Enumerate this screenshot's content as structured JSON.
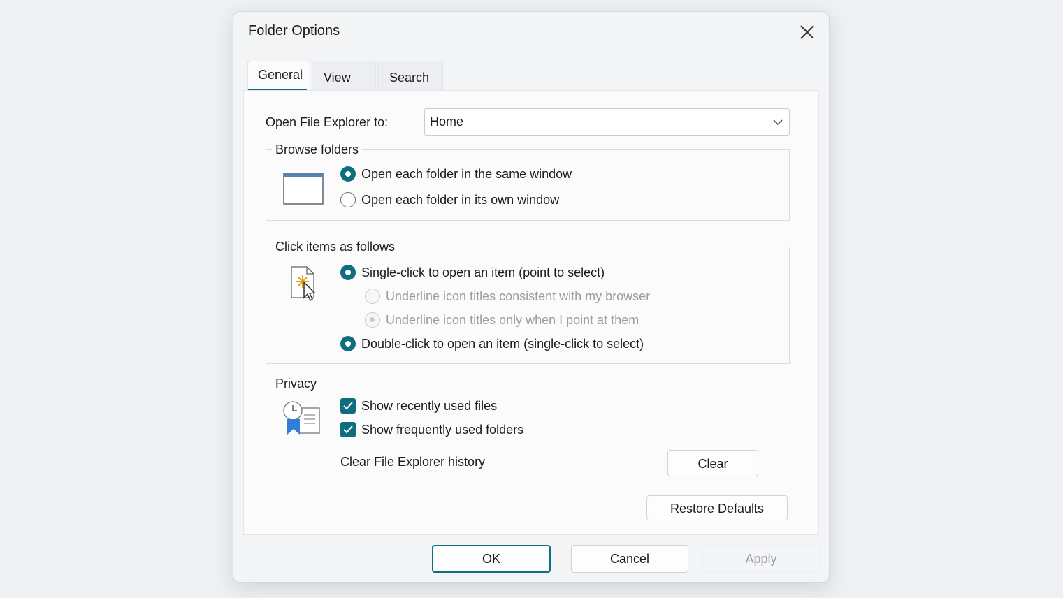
{
  "dialog": {
    "title": "Folder Options"
  },
  "tabs": [
    {
      "label": "General",
      "active": true
    },
    {
      "label": "View",
      "active": false
    },
    {
      "label": "Search",
      "active": false
    }
  ],
  "open_to": {
    "label": "Open File Explorer to:",
    "value": "Home"
  },
  "browse": {
    "title": "Browse folders",
    "options": [
      {
        "label": "Open each folder in the same window",
        "selected": true
      },
      {
        "label": "Open each folder in its own window",
        "selected": false
      }
    ]
  },
  "click": {
    "title": "Click items as follows",
    "options": [
      {
        "label": "Single-click to open an item (point to select)",
        "selected": true
      },
      {
        "label": "Underline icon titles consistent with my browser",
        "selected": false,
        "disabled": true
      },
      {
        "label": "Underline icon titles only when I point at them",
        "selected": true,
        "disabled": true
      },
      {
        "label": "Double-click to open an item (single-click to select)",
        "selected": true
      }
    ]
  },
  "privacy": {
    "title": "Privacy",
    "checks": [
      {
        "label": "Show recently used files",
        "checked": true
      },
      {
        "label": "Show frequently used folders",
        "checked": true
      }
    ],
    "clear_label": "Clear File Explorer history",
    "clear_button": "Clear"
  },
  "restore_button": "Restore Defaults",
  "footer": {
    "ok": "OK",
    "cancel": "Cancel",
    "apply": "Apply"
  },
  "colors": {
    "accent": "#0f6e7e",
    "background": "#eef0f3"
  },
  "icons": [
    "close-icon",
    "chevron-down-icon",
    "window-icon",
    "click-cursor-icon",
    "recent-files-icon",
    "checkmark-icon"
  ]
}
